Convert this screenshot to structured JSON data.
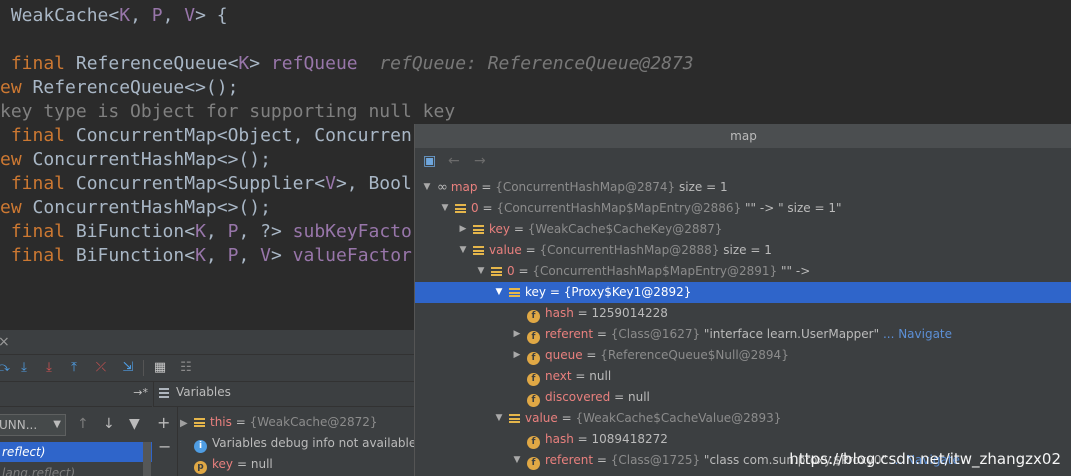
{
  "editor": {
    "lines": [
      {
        "parts": [
          {
            "c": "tok-txt",
            "t": " WeakCache<"
          },
          {
            "c": "tok-tp",
            "t": "K"
          },
          {
            "c": "tok-txt",
            "t": ", "
          },
          {
            "c": "tok-tp",
            "t": "P"
          },
          {
            "c": "tok-txt",
            "t": ", "
          },
          {
            "c": "tok-tp",
            "t": "V"
          },
          {
            "c": "tok-txt",
            "t": "> {"
          }
        ]
      },
      {
        "parts": []
      },
      {
        "parts": [
          {
            "c": "tok-kw",
            "t": " final "
          },
          {
            "c": "tok-txt",
            "t": "ReferenceQueue<"
          },
          {
            "c": "tok-tp",
            "t": "K"
          },
          {
            "c": "tok-txt",
            "t": "> "
          },
          {
            "c": "tok-fd",
            "t": "refQueue"
          },
          {
            "c": "tok-hint",
            "t": "  refQueue: ReferenceQueue@2873"
          }
        ]
      },
      {
        "parts": [
          {
            "c": "tok-kw",
            "t": "ew "
          },
          {
            "c": "tok-txt",
            "t": "ReferenceQueue<>();"
          }
        ]
      },
      {
        "parts": [
          {
            "c": "tok-cmt",
            "t": "key type is Object for supporting null key"
          }
        ]
      },
      {
        "parts": [
          {
            "c": "tok-kw",
            "t": " final "
          },
          {
            "c": "tok-txt",
            "t": "ConcurrentMap<Object, Concurren"
          }
        ]
      },
      {
        "parts": [
          {
            "c": "tok-kw",
            "t": "ew "
          },
          {
            "c": "tok-txt",
            "t": "ConcurrentHashMap<>();"
          }
        ]
      },
      {
        "parts": [
          {
            "c": "tok-kw",
            "t": " final "
          },
          {
            "c": "tok-txt",
            "t": "ConcurrentMap<Supplier<"
          },
          {
            "c": "tok-tp",
            "t": "V"
          },
          {
            "c": "tok-txt",
            "t": ">, Bool"
          }
        ]
      },
      {
        "parts": [
          {
            "c": "tok-kw",
            "t": "ew "
          },
          {
            "c": "tok-txt",
            "t": "ConcurrentHashMap<>();"
          }
        ]
      },
      {
        "parts": [
          {
            "c": "tok-kw",
            "t": " final "
          },
          {
            "c": "tok-txt",
            "t": "BiFunction<"
          },
          {
            "c": "tok-tp",
            "t": "K"
          },
          {
            "c": "tok-txt",
            "t": ", "
          },
          {
            "c": "tok-tp",
            "t": "P"
          },
          {
            "c": "tok-txt",
            "t": ", ?> "
          },
          {
            "c": "tok-fd",
            "t": "subKeyFacto"
          }
        ]
      },
      {
        "parts": [
          {
            "c": "tok-kw",
            "t": " final "
          },
          {
            "c": "tok-txt",
            "t": "BiFunction<"
          },
          {
            "c": "tok-tp",
            "t": "K"
          },
          {
            "c": "tok-txt",
            "t": ", "
          },
          {
            "c": "tok-tp",
            "t": "P"
          },
          {
            "c": "tok-txt",
            "t": ", "
          },
          {
            "c": "tok-tp",
            "t": "V"
          },
          {
            "c": "tok-txt",
            "t": "> "
          },
          {
            "c": "tok-fd",
            "t": "valueFactor"
          }
        ]
      }
    ]
  },
  "debugger": {
    "close_glyph": "×",
    "frames_pin": "→*",
    "variables_label": "Variables",
    "thread_value": "UNN...",
    "frames": [
      {
        "label": "reflect)",
        "selected": true
      },
      {
        "label": "lang.reflect)",
        "selected": false
      }
    ],
    "variables": [
      {
        "expand": "▶",
        "icon": "list",
        "name": "this",
        "type": "{WeakCache@2872}"
      },
      {
        "expand": "",
        "icon": "i",
        "text": "Variables debug info not available"
      },
      {
        "expand": "",
        "icon": "p",
        "name": "key",
        "value": "= null"
      }
    ]
  },
  "popup": {
    "title": "map",
    "rows": [
      {
        "depth": 0,
        "twisty": "▼",
        "icon": "oo",
        "name": "map",
        "type": "{ConcurrentHashMap@2874}",
        "value": " size = 1",
        "selected": false
      },
      {
        "depth": 1,
        "twisty": "▼",
        "icon": "list",
        "name": "0",
        "type": "{ConcurrentHashMap$MapEntry@2886}",
        "value": " \"\" -> \" size = 1\"",
        "selected": false
      },
      {
        "depth": 2,
        "twisty": "▶",
        "icon": "list",
        "name": "key",
        "type": "{WeakCache$CacheKey@2887}",
        "value": "",
        "selected": false
      },
      {
        "depth": 2,
        "twisty": "▼",
        "icon": "list",
        "name": "value",
        "type": "{ConcurrentHashMap@2888}",
        "value": " size = 1",
        "selected": false
      },
      {
        "depth": 3,
        "twisty": "▼",
        "icon": "list",
        "name": "0",
        "type": "{ConcurrentHashMap$MapEntry@2891}",
        "value": " \"\" ->",
        "selected": false
      },
      {
        "depth": 4,
        "twisty": "▼",
        "icon": "list",
        "name": "key",
        "type": "{Proxy$Key1@2892}",
        "value": "",
        "selected": true
      },
      {
        "depth": 5,
        "twisty": "",
        "icon": "f",
        "name": "hash",
        "type": "",
        "value": "1259014228",
        "selected": false
      },
      {
        "depth": 5,
        "twisty": "▶",
        "icon": "f",
        "name": "referent",
        "type": "{Class@1627}",
        "value": " \"interface learn.UserMapper\"",
        "nav": " ... Navigate",
        "selected": false
      },
      {
        "depth": 5,
        "twisty": "▶",
        "icon": "f",
        "name": "queue",
        "type": "{ReferenceQueue$Null@2894}",
        "value": "",
        "selected": false
      },
      {
        "depth": 5,
        "twisty": "",
        "icon": "f",
        "name": "next",
        "type": "",
        "value": "null",
        "selected": false
      },
      {
        "depth": 5,
        "twisty": "",
        "icon": "f",
        "name": "discovered",
        "type": "",
        "value": "null",
        "selected": false
      },
      {
        "depth": 4,
        "twisty": "▼",
        "icon": "list",
        "name": "value",
        "type": "{WeakCache$CacheValue@2893}",
        "value": "",
        "selected": false
      },
      {
        "depth": 5,
        "twisty": "",
        "icon": "f",
        "name": "hash",
        "type": "",
        "value": "1089418272",
        "selected": false
      },
      {
        "depth": 5,
        "twisty": "▼",
        "icon": "f",
        "name": "referent",
        "type": "{Class@1725}",
        "value": " \"class com.sun.proxy.$Proxy0\"",
        "nav": " ... Navigate",
        "selected": false
      }
    ]
  },
  "watermark": "https://blog.csdn.net/itw_zhangzx02",
  "colors": {
    "editor_bg": "#2b2b2b",
    "panel_bg": "#3c3f41",
    "selection": "#2f65ca",
    "keyword": "#cc7832",
    "type_param": "#9876aa",
    "comment": "#808080"
  }
}
